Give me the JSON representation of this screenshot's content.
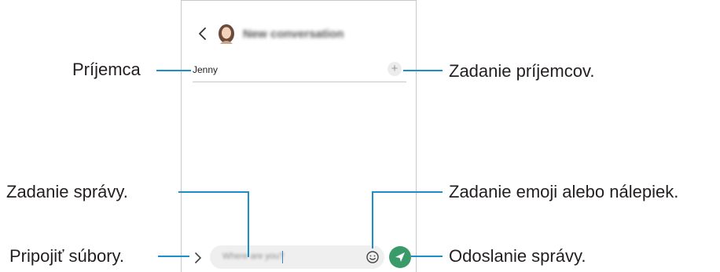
{
  "screen": {
    "title": "New conversation",
    "recipient": "Jenny",
    "add_button": "+",
    "message_placeholder": "Where are you?"
  },
  "callouts": {
    "recipient": "Príjemca",
    "enter_recipients": "Zadanie príjemcov.",
    "enter_message": "Zadanie správy.",
    "enter_emoji": "Zadanie emoji alebo nálepiek.",
    "attach_files": "Pripojiť súbory.",
    "send_message": "Odoslanie správy."
  },
  "colors": {
    "callout_line": "#1a8fcc",
    "send_button": "#3a9a6a"
  },
  "icons": [
    "back-arrow-icon",
    "contact-avatar-icon",
    "plus-icon",
    "attach-chevron-icon",
    "emoji-icon",
    "send-icon"
  ]
}
